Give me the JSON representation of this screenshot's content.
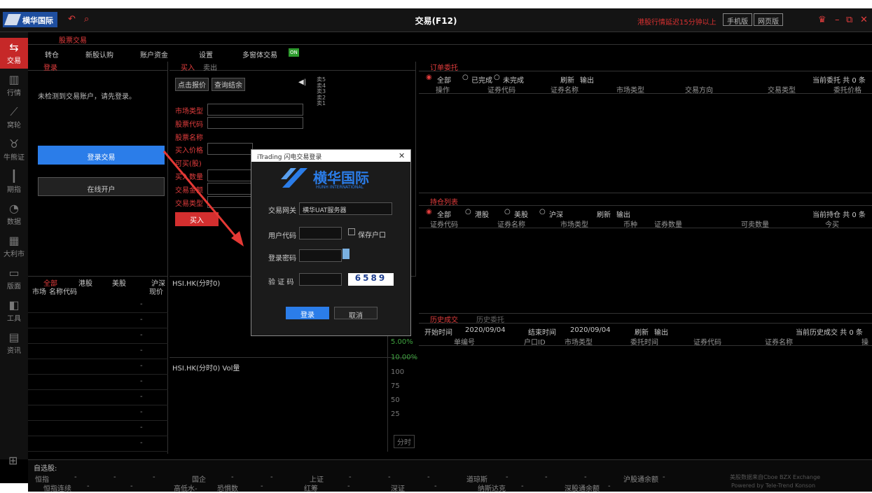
{
  "titlebar": {
    "logo": "横华国际",
    "title": "交易(F12)",
    "warning": "港股行情延迟15分钟以上",
    "mobile_btn": "手机版",
    "web_btn": "网页版"
  },
  "nav": [
    {
      "label": "交易",
      "icon": "transfer-icon"
    },
    {
      "label": "行情",
      "icon": "bar-chart-icon"
    },
    {
      "label": "窝轮",
      "icon": "line-chart-icon"
    },
    {
      "label": "牛熊证",
      "icon": "bull-icon"
    },
    {
      "label": "期指",
      "icon": "candle-icon"
    },
    {
      "label": "数据",
      "icon": "pie-icon"
    },
    {
      "label": "大利市",
      "icon": "grid-icon"
    },
    {
      "label": "版面",
      "icon": "layout-icon"
    },
    {
      "label": "工具",
      "icon": "tool-icon"
    },
    {
      "label": "资讯",
      "icon": "news-icon"
    }
  ],
  "tabs": {
    "stock_trade": "股票交易"
  },
  "toolbar": {
    "transfer": "转仓",
    "ipo": "新股认购",
    "funds": "账户资金",
    "settings": "设置",
    "multi": "多窗体交易",
    "on": "ON"
  },
  "login_panel": {
    "tab": "登录",
    "message": "未检测到交易账户，请先登录。",
    "login_btn": "登录交易",
    "open_btn": "在线开户"
  },
  "buy_panel": {
    "buy_tab": "买入",
    "sell_tab": "卖出",
    "quote_btn": "点击报价",
    "query_btn": "查询结余",
    "market_type": "市场类型",
    "code": "股票代码",
    "name": "股票名称",
    "price": "买入价格",
    "can_buy": "可买(股)",
    "qty": "买入数量",
    "amount": "交易金额",
    "type": "交易类型",
    "buy_btn": "买入",
    "sell_levels": [
      "卖5",
      "卖4",
      "卖3",
      "卖2",
      "卖1"
    ]
  },
  "watch": {
    "tabs": [
      "全部",
      "港股",
      "美股",
      "沪深"
    ],
    "col_market": "市场",
    "col_name": "名称代码",
    "col_price": "现价",
    "chart_title": "HSI.HK(分时0)",
    "vol_title": "HSI.HK(分时0) Vol量",
    "pct": [
      "5.00%",
      "10.00%"
    ],
    "vol_ticks": [
      "100",
      "75",
      "50",
      "25"
    ],
    "dash": "-",
    "fenshi": "分时"
  },
  "orders": {
    "title": "订单委托",
    "filters": [
      "全部",
      "已完成",
      "未完成"
    ],
    "refresh": "刷新",
    "export": "输出",
    "count": "当前委托 共 0 条",
    "cols": [
      "操作",
      "证券代码",
      "证券名称",
      "市场类型",
      "交易方向",
      "交易类型",
      "委托价格"
    ]
  },
  "holdings": {
    "title": "持仓列表",
    "filters": [
      "全部",
      "港股",
      "美股",
      "沪深"
    ],
    "refresh": "刷新",
    "export": "输出",
    "count": "当前持仓 共 0 条",
    "cols": [
      "证券代码",
      "证券名称",
      "市场类型",
      "币种",
      "证券数量",
      "可卖数量",
      "今买"
    ]
  },
  "history": {
    "tab1": "历史成交",
    "tab2": "历史委托",
    "start_label": "开始时间",
    "start": "2020/09/04",
    "end_label": "结束时间",
    "end": "2020/09/04",
    "refresh": "刷新",
    "export": "输出",
    "count": "当前历史成交 共 0 条",
    "cols": [
      "单编号",
      "户口ID",
      "市场类型",
      "委托时间",
      "证券代码",
      "证券名称",
      "操"
    ]
  },
  "dialog": {
    "title": "iTrading 闪电交易登录",
    "brand": "横华国际",
    "brand_en": "HUNH INTERNATIONAL",
    "gateway_label": "交易网关",
    "gateway": "横华UAT服务器",
    "user_label": "用户代码",
    "save_label": "保存户口",
    "pwd_label": "登录密码",
    "captcha_label": "验 证 码",
    "captcha": "6589",
    "login": "登录",
    "cancel": "取消"
  },
  "bottom": {
    "watchlist": "自选股:",
    "row1": [
      "恒指",
      "-",
      "-",
      "-",
      "国企",
      "-",
      "-",
      "上证",
      "-",
      "-",
      "-",
      "道琼斯",
      "-",
      "-",
      "-",
      "沪股通余额",
      "-"
    ],
    "row2": [
      "恒指连续",
      "-",
      "-",
      "高低水-",
      "恐惧数",
      "-",
      "红筹",
      "-",
      "深证",
      "-",
      "纳斯达克",
      "-",
      "深股通余额",
      "-"
    ],
    "credit1": "美股数据来自Cboe BZX Exchange",
    "credit2": "Powered by Tele-Trend Konson"
  }
}
